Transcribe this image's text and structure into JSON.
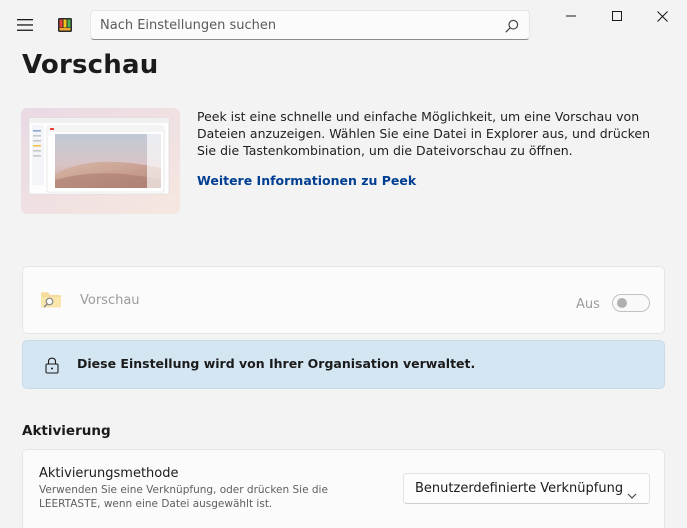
{
  "titlebar": {
    "search": {
      "placeholder": "Nach Einstellungen suchen"
    }
  },
  "page": {
    "title": "Vorschau"
  },
  "hero": {
    "description": "Peek ist eine schnelle und einfache Möglichkeit, um eine Vorschau von Dateien anzuzeigen. Wählen Sie eine Datei in Explorer aus, und drücken Sie die Tastenkombination, um die Dateivorschau zu öffnen.",
    "link_label": "Weitere Informationen zu Peek"
  },
  "preview_setting": {
    "label": "Vorschau",
    "state_label": "Aus",
    "enabled": false
  },
  "policy_info": {
    "text": "Diese Einstellung wird von Ihrer Organisation verwaltet."
  },
  "activation": {
    "section_header": "Aktivierung",
    "title": "Aktivierungsmethode",
    "description": "Verwenden Sie eine Verknüpfung, oder drücken Sie die LEERTASTE, wenn eine Datei ausgewählt ist.",
    "selected_option": "Benutzerdefinierte Verknüpfung"
  },
  "colors": {
    "accent_link": "#003e92",
    "info_bar": "#d5e6f3",
    "background": "#f3f3f3"
  }
}
